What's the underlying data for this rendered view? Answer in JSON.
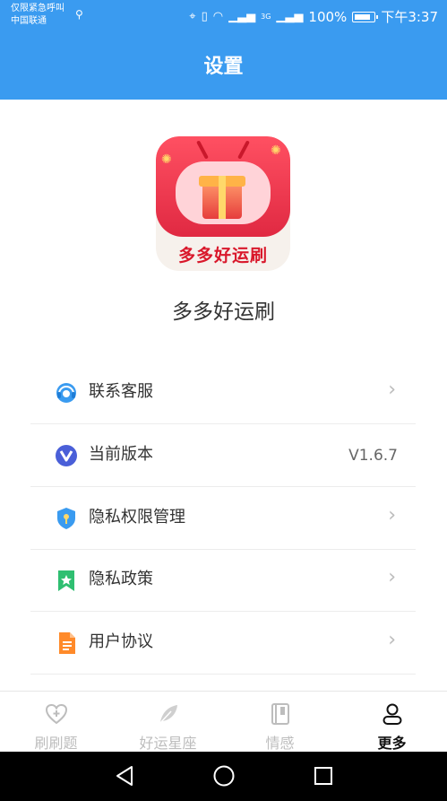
{
  "status_bar": {
    "emergency": "仅限紧急呼叫",
    "carrier": "中国联通",
    "network": "3G",
    "battery_text": "100%",
    "time": "下午3:37"
  },
  "header": {
    "title": "设置",
    "background": "#3a9bf0"
  },
  "app": {
    "logo_text": "多多好运刷",
    "name": "多多好运刷"
  },
  "menu": [
    {
      "label": "联系客服",
      "icon": "customer-service-icon"
    },
    {
      "label": "当前版本",
      "icon": "version-icon",
      "value": "V1.6.7"
    },
    {
      "label": "隐私权限管理",
      "icon": "privacy-shield-icon"
    },
    {
      "label": "隐私政策",
      "icon": "bookmark-star-icon"
    },
    {
      "label": "用户协议",
      "icon": "document-icon"
    }
  ],
  "tabbar": {
    "active": "更多",
    "items": [
      {
        "label": "刷刷题",
        "icon": "heart-plus-icon"
      },
      {
        "label": "好运星座",
        "icon": "feather-icon"
      },
      {
        "label": "情感",
        "icon": "notebook-icon"
      },
      {
        "label": "更多",
        "icon": "user-icon"
      }
    ]
  },
  "system_nav": {
    "icons": [
      "back-icon",
      "home-icon",
      "recents-icon"
    ]
  }
}
